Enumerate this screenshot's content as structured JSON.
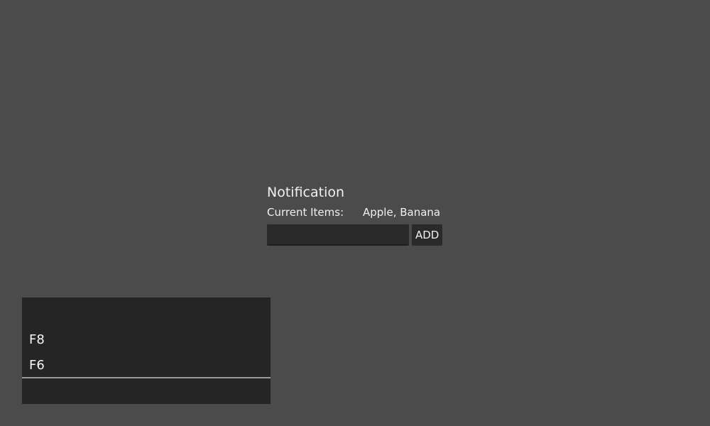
{
  "notification": {
    "title": "Notification",
    "items_label": "Current Items:",
    "items_value": "Apple, Banana",
    "input_value": "",
    "input_placeholder": "",
    "add_label": "ADD"
  },
  "list_panel": {
    "items": [
      {
        "label": "F8"
      },
      {
        "label": "F6"
      }
    ]
  },
  "colors": {
    "background": "#4b4b4b",
    "panel": "#252525",
    "input": "#2a2a2a",
    "text": "#f0f0f0",
    "divider": "#9a9a9a"
  }
}
